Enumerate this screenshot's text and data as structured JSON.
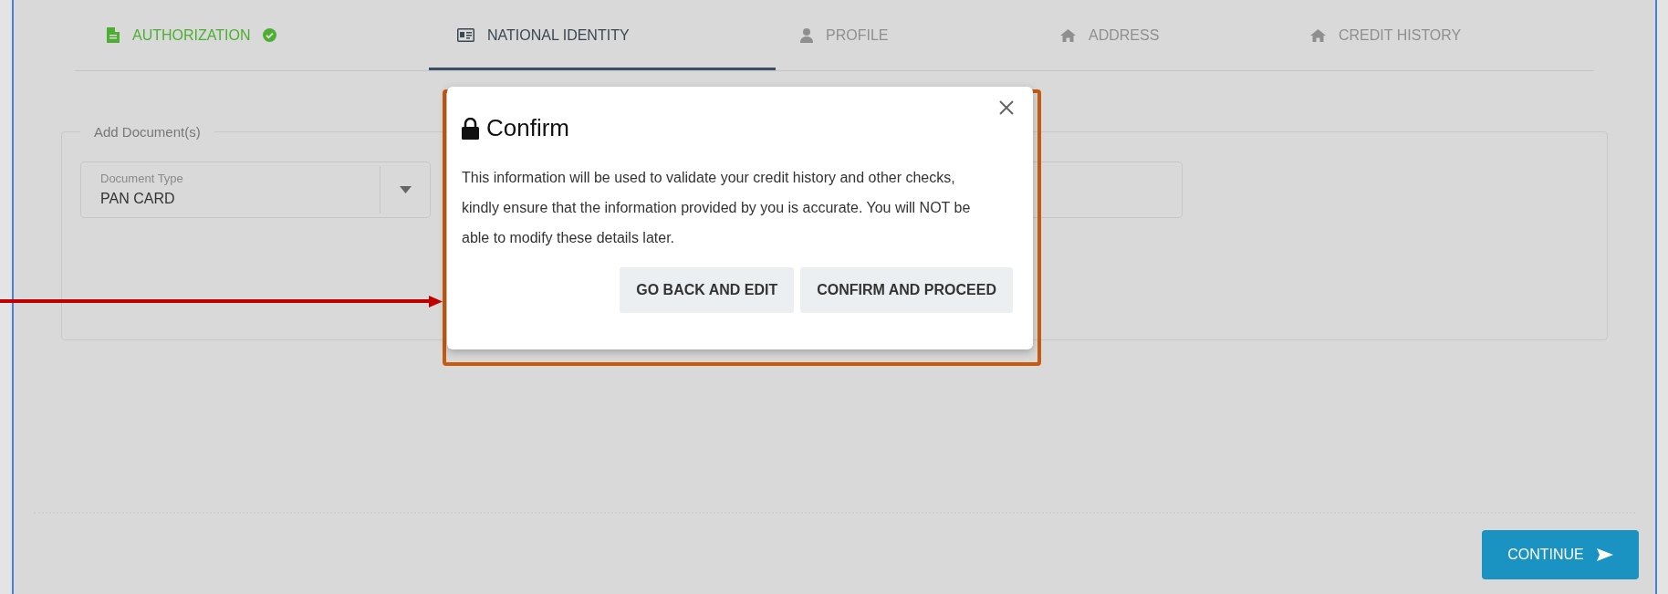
{
  "tabs": [
    {
      "label": "AUTHORIZATION",
      "selected": false,
      "completed": true,
      "disabled": false
    },
    {
      "label": "NATIONAL IDENTITY",
      "selected": true,
      "completed": false,
      "disabled": false
    },
    {
      "label": "PROFILE",
      "selected": false,
      "completed": false,
      "disabled": true
    },
    {
      "label": "ADDRESS",
      "selected": false,
      "completed": false,
      "disabled": true
    },
    {
      "label": "CREDIT HISTORY",
      "selected": false,
      "completed": false,
      "disabled": true
    }
  ],
  "form": {
    "legend": "Add Document(s)",
    "document_type": {
      "label": "Document Type",
      "value": "PAN CARD"
    }
  },
  "dialog": {
    "title": "Confirm",
    "message": "This information will be used to validate your credit history and other checks, kindly ensure that the information provided by you is accurate. You will NOT be able to modify these details later.",
    "buttons": [
      "GO BACK AND EDIT",
      "CONFIRM AND PROCEED"
    ]
  },
  "continue_button": {
    "label": "CONTINUE"
  }
}
